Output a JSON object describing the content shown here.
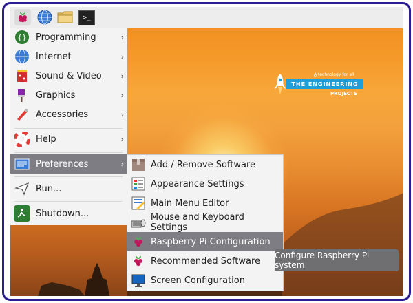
{
  "menu": {
    "items": [
      {
        "label": "Programming",
        "icon": "programming-icon",
        "has_submenu": true
      },
      {
        "label": "Internet",
        "icon": "internet-icon",
        "has_submenu": true
      },
      {
        "label": "Sound & Video",
        "icon": "sound-video-icon",
        "has_submenu": true
      },
      {
        "label": "Graphics",
        "icon": "graphics-icon",
        "has_submenu": true
      },
      {
        "label": "Accessories",
        "icon": "accessories-icon",
        "has_submenu": true
      },
      {
        "label": "Help",
        "icon": "help-icon",
        "has_submenu": true
      },
      {
        "label": "Preferences",
        "icon": "preferences-icon",
        "has_submenu": true,
        "selected": true
      },
      {
        "label": "Run...",
        "icon": "run-icon",
        "has_submenu": false
      },
      {
        "label": "Shutdown...",
        "icon": "shutdown-icon",
        "has_submenu": false
      }
    ],
    "arrow": "›"
  },
  "submenu": {
    "items": [
      {
        "label": "Add / Remove Software",
        "icon": "package-icon"
      },
      {
        "label": "Appearance Settings",
        "icon": "appearance-icon"
      },
      {
        "label": "Main Menu Editor",
        "icon": "menu-editor-icon"
      },
      {
        "label": "Mouse and Keyboard Settings",
        "icon": "keyboard-mouse-icon"
      },
      {
        "label": "Raspberry Pi Configuration",
        "icon": "raspberry-icon",
        "selected": true
      },
      {
        "label": "Recommended Software",
        "icon": "raspberry-icon"
      },
      {
        "label": "Screen Configuration",
        "icon": "monitor-icon"
      }
    ]
  },
  "tooltip": {
    "text": "Configure Raspberry Pi system"
  },
  "taskbar": {
    "terminal_glyph": ">_"
  },
  "watermark": {
    "small": "A̲ technology for all",
    "band": "THE ENGINEERING",
    "sub": "PROJECTS"
  },
  "colors": {
    "selection": "#7d7d83",
    "menu_bg": "#f3f3f3",
    "frame": "#2b1e8f"
  }
}
